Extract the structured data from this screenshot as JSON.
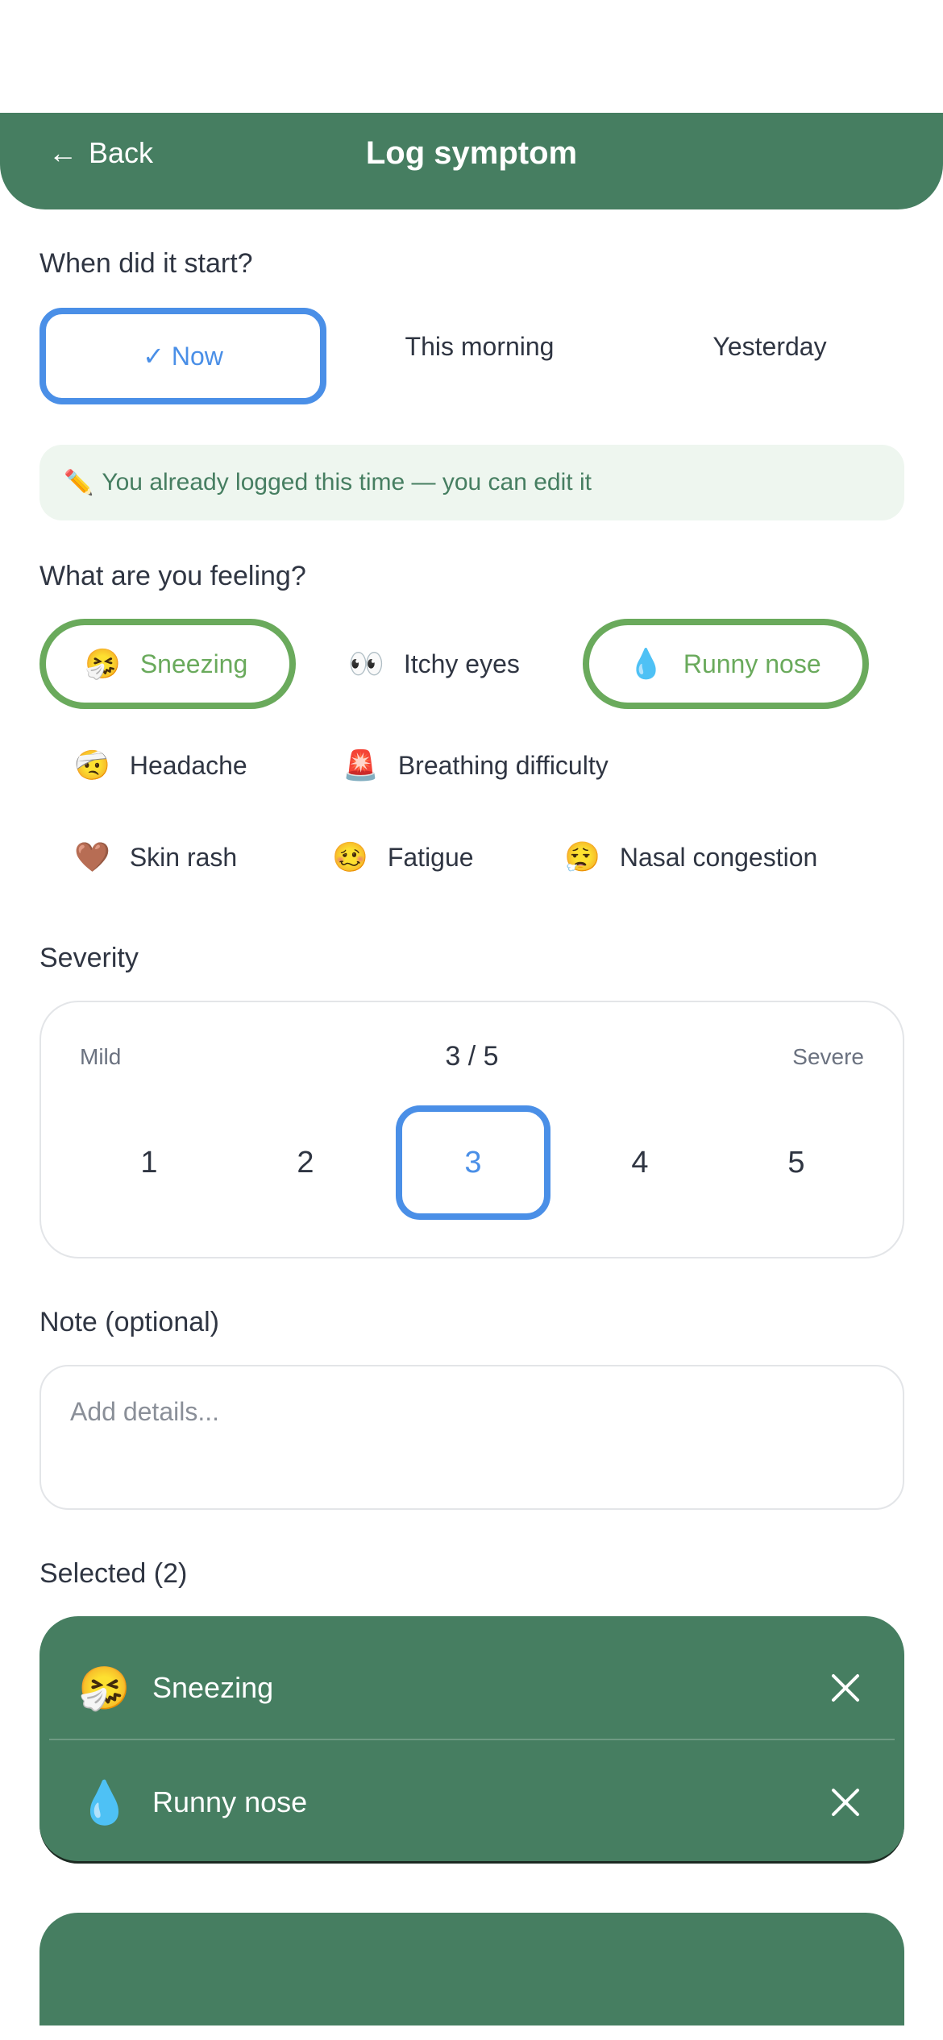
{
  "header": {
    "back_label": "Back",
    "back_arrow": "←",
    "title": "Log symptom"
  },
  "when": {
    "label": "When did it start?",
    "options": [
      {
        "label": "✓ Now",
        "selected": true
      },
      {
        "label": "This morning",
        "selected": false
      },
      {
        "label": "Yesterday",
        "selected": false
      }
    ]
  },
  "notice": {
    "icon": "✏️",
    "text": "You already logged this time — you can edit it"
  },
  "feeling": {
    "label": "What are you feeling?",
    "symptoms": [
      {
        "emoji": "🤧",
        "label": "Sneezing",
        "selected": true
      },
      {
        "emoji": "👀",
        "label": "Itchy eyes",
        "selected": false
      },
      {
        "emoji": "💧",
        "label": "Runny nose",
        "selected": true
      },
      {
        "emoji": "🤕",
        "label": "Headache",
        "selected": false
      },
      {
        "emoji": "🚨",
        "label": "Breathing difficulty",
        "selected": false
      },
      {
        "emoji": "🤎",
        "label": "Skin rash",
        "selected": false
      },
      {
        "emoji": "🥴",
        "label": "Fatigue",
        "selected": false
      },
      {
        "emoji": "😮‍💨",
        "label": "Nasal congestion",
        "selected": false
      }
    ]
  },
  "severity": {
    "label": "Severity",
    "min_label": "Mild",
    "max_label": "Severe",
    "value_text": "3 / 5",
    "levels": [
      "1",
      "2",
      "3",
      "4",
      "5"
    ],
    "selected_level": 3
  },
  "note": {
    "label": "Note (optional)",
    "placeholder": "Add details...",
    "value": ""
  },
  "selected": {
    "label": "Selected (2)",
    "items": [
      {
        "emoji": "🤧",
        "label": "Sneezing"
      },
      {
        "emoji": "💧",
        "label": "Runny nose"
      }
    ]
  },
  "colors": {
    "primary_green": "#467e61",
    "chip_selected_green": "#6aaa5c",
    "selected_blue": "#4a8fe7",
    "notice_bg": "#eef6ef"
  }
}
